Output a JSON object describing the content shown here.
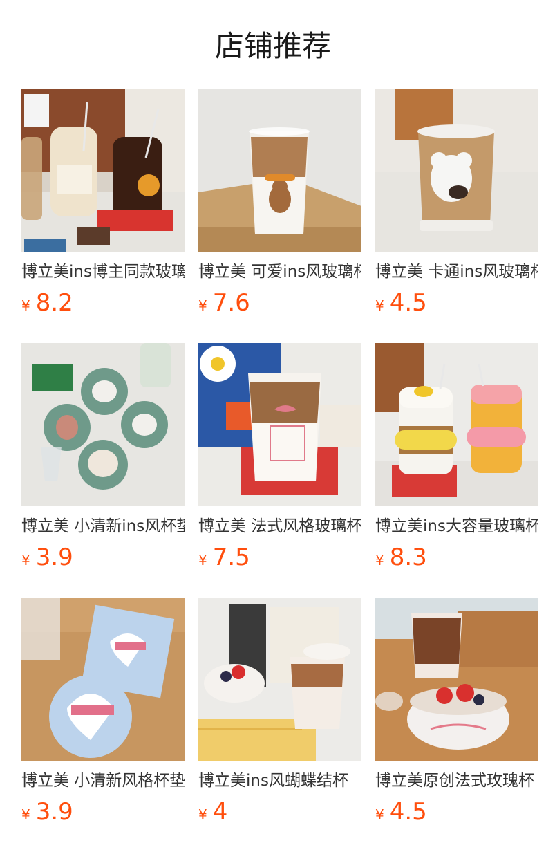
{
  "page": {
    "title": "店铺推荐"
  },
  "currency": "¥",
  "products": [
    {
      "name": "博立美ins博主同款玻璃杯",
      "price": "8.2",
      "icon": "drink-bottles-image"
    },
    {
      "name": "博立美 可爱ins风玻璃杯",
      "price": "7.6",
      "icon": "latte-glass-dog-image"
    },
    {
      "name": "博立美 卡通ins风玻璃杯",
      "price": "4.5",
      "icon": "bear-glass-image"
    },
    {
      "name": "博立美 小清新ins风杯垫",
      "price": "3.9",
      "icon": "round-coasters-image"
    },
    {
      "name": "博立美 法式风格玻璃杯",
      "price": "7.5",
      "icon": "ribbon-glass-image"
    },
    {
      "name": "博立美ins大容量玻璃杯",
      "price": "8.3",
      "icon": "straw-cups-image"
    },
    {
      "name": "博立美 小清新风格杯垫",
      "price": "3.9",
      "icon": "heart-coasters-image"
    },
    {
      "name": "博立美ins风蝴蝶结杯",
      "price": "4",
      "icon": "bow-cup-bowl-image"
    },
    {
      "name": "博立美原创法式玫瑰杯",
      "price": "4.5",
      "icon": "rose-bowl-image"
    }
  ],
  "colors": {
    "price": "#ff4e0d",
    "title": "#1a1a1a",
    "text": "#333333"
  }
}
